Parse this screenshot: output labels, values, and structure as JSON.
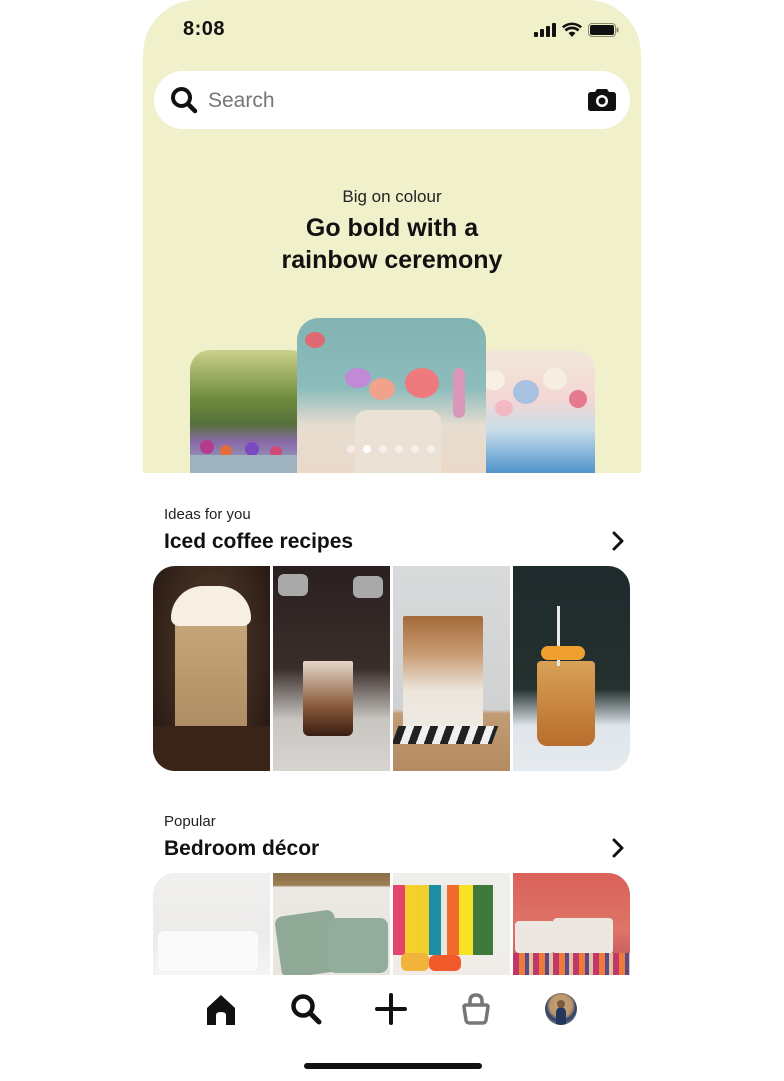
{
  "status_bar": {
    "time": "8:08",
    "icons": [
      "signal-icon",
      "wifi-icon",
      "battery-icon"
    ]
  },
  "search": {
    "placeholder": "Search",
    "value": "",
    "left_icon": "search-icon",
    "right_icon": "camera-icon"
  },
  "hero": {
    "kicker": "Big on colour",
    "headline_line1": "Go bold with a",
    "headline_line2": "rainbow ceremony",
    "background_color": "#f0f0cb",
    "carousel": {
      "slide_count": 6,
      "active_index": 1
    }
  },
  "sections": [
    {
      "subtitle": "Ideas for you",
      "title": "Iced coffee recipes",
      "arrow_icon": "chevron-right-icon",
      "tiles": [
        "caramel-iced-latte",
        "milk-pour-iced-coffee",
        "iced-latte-on-coaster",
        "iced-tea-with-orange"
      ]
    },
    {
      "subtitle": "Popular",
      "title": "Bedroom décor",
      "arrow_icon": "chevron-right-icon",
      "tiles": [
        "white-bedroom",
        "green-pillows",
        "rainbow-headboard",
        "red-wall-striped-bedding"
      ]
    }
  ],
  "nav": {
    "items": [
      {
        "name": "home",
        "icon": "home-icon",
        "active": true
      },
      {
        "name": "search",
        "icon": "search-icon",
        "active": false
      },
      {
        "name": "create",
        "icon": "plus-icon",
        "active": false
      },
      {
        "name": "shop",
        "icon": "shopping-bag-icon",
        "active": false
      },
      {
        "name": "profile",
        "icon": "avatar",
        "active": false
      }
    ]
  }
}
